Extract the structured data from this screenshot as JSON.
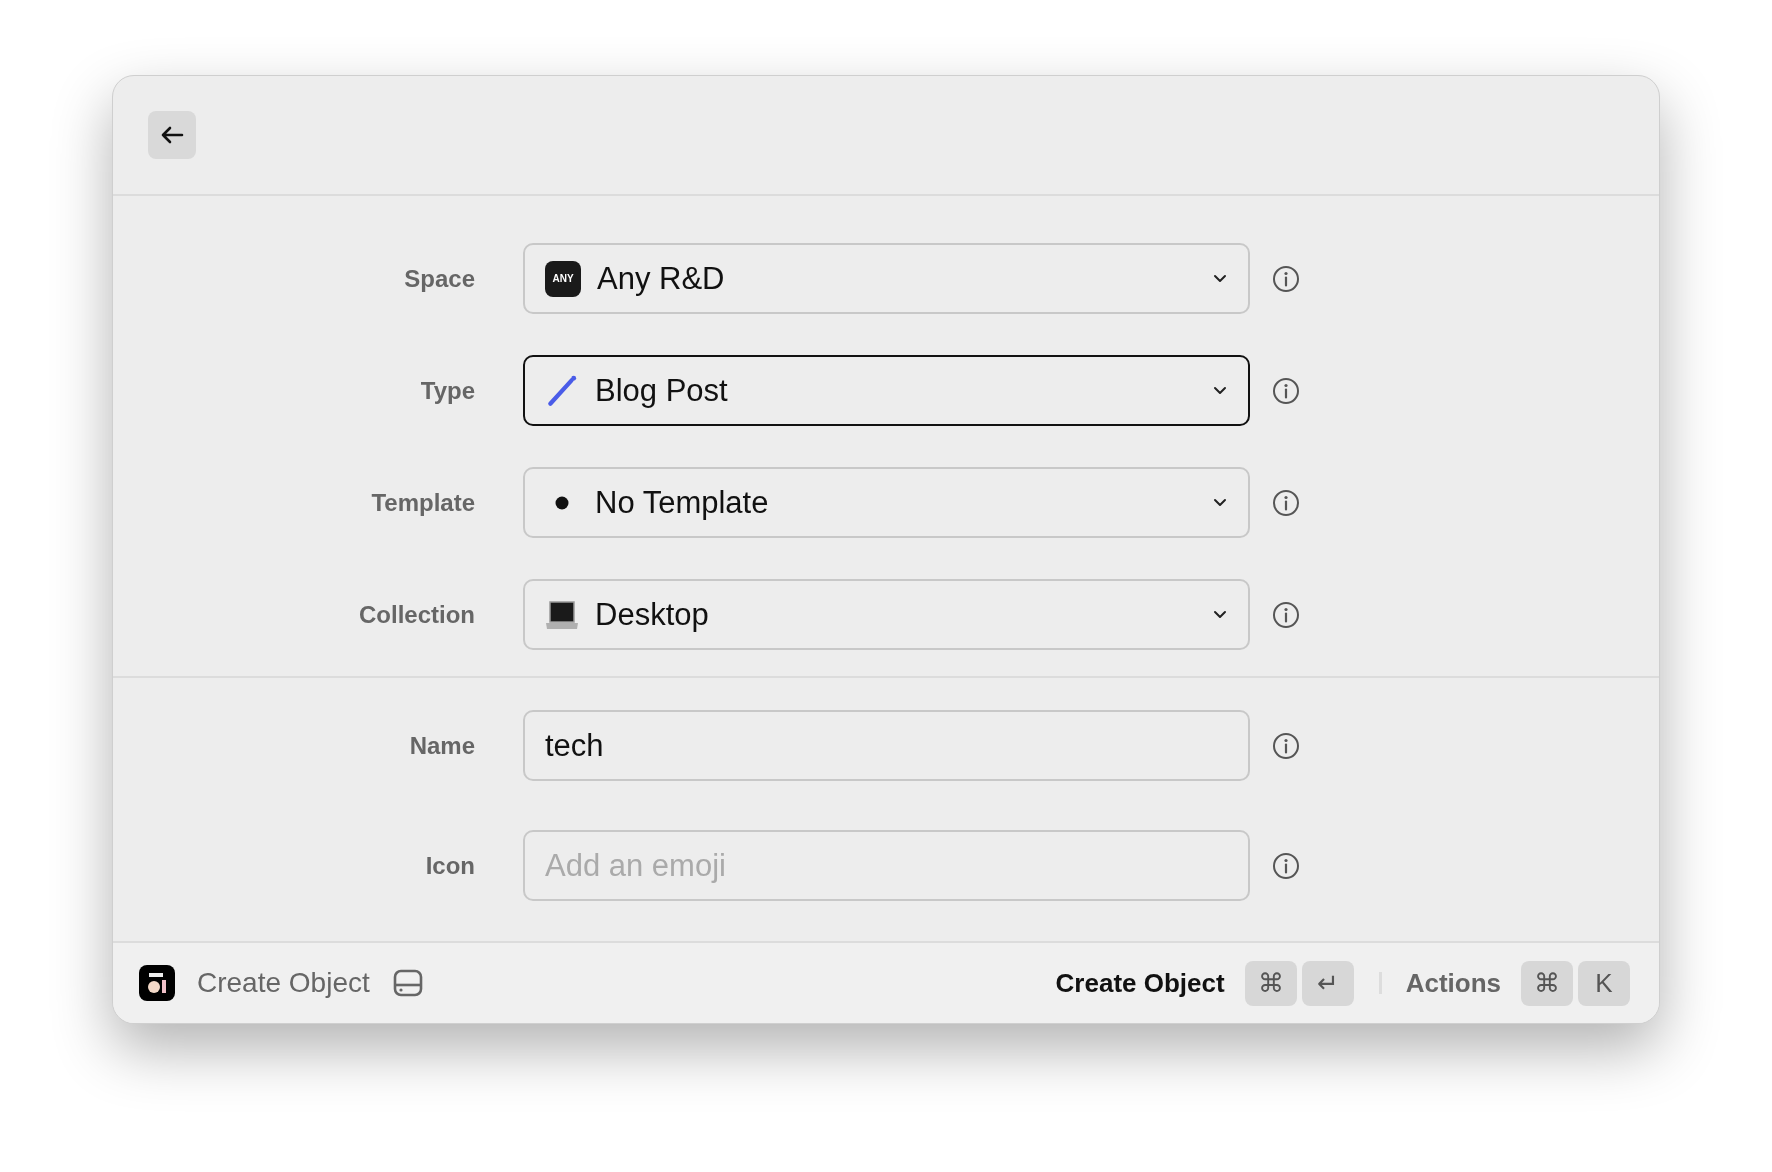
{
  "selectors": [
    {
      "label": "Space",
      "value": "Any R&D",
      "logo_text": "ANY",
      "focused": false
    },
    {
      "label": "Type",
      "value": "Blog Post",
      "focused": true
    },
    {
      "label": "Template",
      "value": "No Template",
      "focused": false
    },
    {
      "label": "Collection",
      "value": "Desktop",
      "focused": false
    }
  ],
  "fields": [
    {
      "label": "Name",
      "value": "tech",
      "focused": false
    },
    {
      "label": "Icon",
      "placeholder": "Add an emoji",
      "focused": false
    }
  ],
  "footer": {
    "title": "Create Object",
    "primary_action": "Create Object",
    "primary_keys": [
      "⌘",
      "↵"
    ],
    "secondary_action": "Actions",
    "secondary_keys": [
      "⌘",
      "K"
    ]
  }
}
